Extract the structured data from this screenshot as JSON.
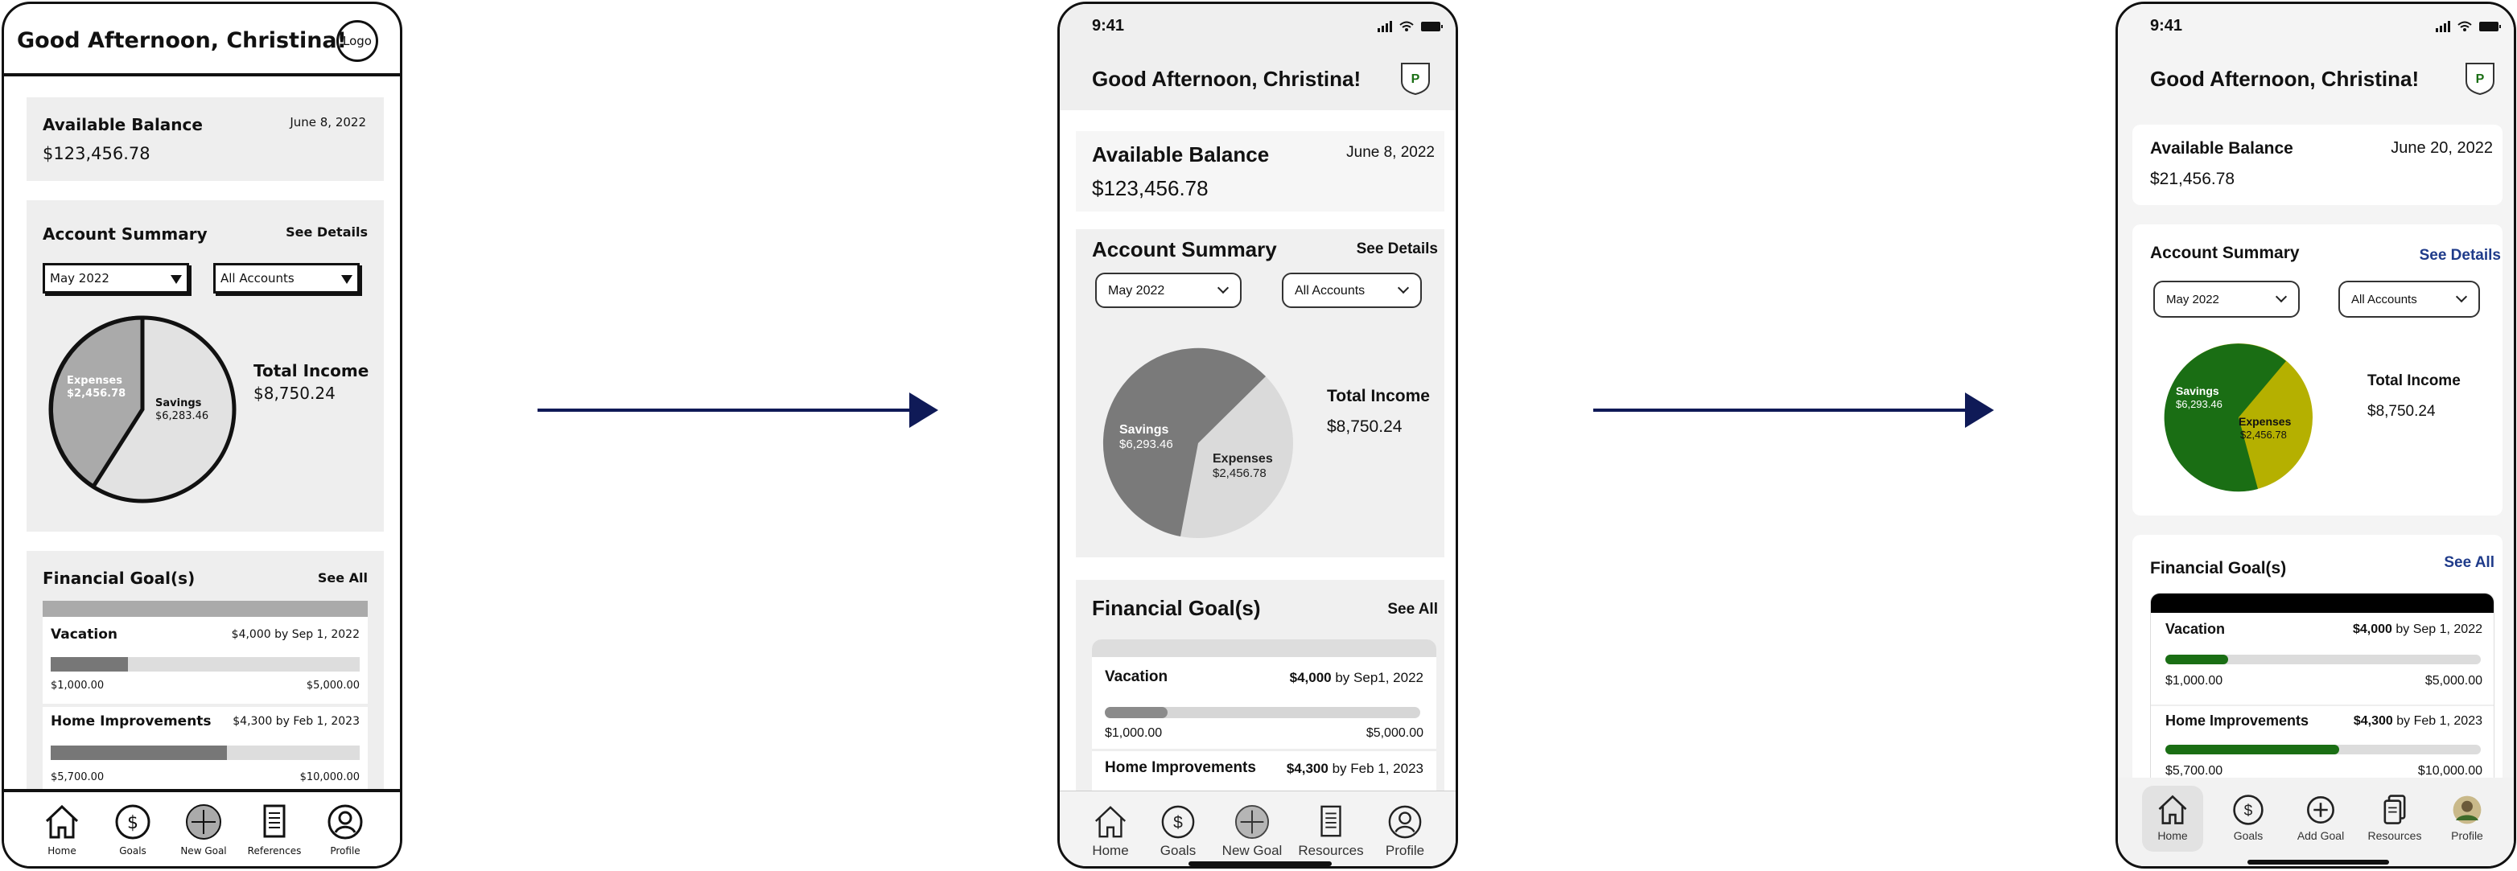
{
  "colors": {
    "arrow": "#0f1a57",
    "final_green": "#1a6e14",
    "final_yellow": "#b5b000",
    "final_link": "#1f3b8a",
    "wire_gray": "#eeeeee"
  },
  "screens": [
    {
      "greeting": "Good Afternoon, Christina!",
      "logo": "Logo",
      "balance": {
        "title": "Available Balance",
        "date": "June 8, 2022",
        "amount": "$123,456.78"
      },
      "summary": {
        "title": "Account Summary",
        "link": "See Details",
        "month": "May 2022",
        "accounts": "All Accounts",
        "pie": {
          "expenses_label": "Expenses",
          "expenses_value": "$2,456.78",
          "savings_label": "Savings",
          "savings_value": "$6,283.46"
        },
        "income_title": "Total Income",
        "income_value": "$8,750.24"
      },
      "goals": {
        "title": "Financial Goal(s)",
        "link": "See All",
        "items": [
          {
            "name": "Vacation",
            "target": "$4,000 by Sep 1, 2022",
            "current": "$1,000.00",
            "goal": "$5,000.00",
            "progress": 0.25
          },
          {
            "name": "Home Improvements",
            "target": "$4,300 by Feb 1, 2023",
            "current": "$5,700.00",
            "goal": "$10,000.00",
            "progress": 0.57
          }
        ]
      },
      "nav": [
        "Home",
        "Goals",
        "New Goal",
        "References",
        "Profile"
      ]
    },
    {
      "time": "9:41",
      "greeting": "Good Afternoon, Christina!",
      "balance": {
        "title": "Available Balance",
        "date": "June 8, 2022",
        "amount": "$123,456.78"
      },
      "summary": {
        "title": "Account Summary",
        "link": "See Details",
        "month": "May 2022",
        "accounts": "All Accounts",
        "pie": {
          "savings_label": "Savings",
          "savings_value": "$6,293.46",
          "expenses_label": "Expenses",
          "expenses_value": "$2,456.78"
        },
        "income_title": "Total Income",
        "income_value": "$8,750.24"
      },
      "goals": {
        "title": "Financial Goal(s)",
        "link": "See All",
        "items": [
          {
            "name": "Vacation",
            "amount": "$4,000",
            "by": "by Sep1, 2022",
            "current": "$1,000.00",
            "goal": "$5,000.00",
            "progress": 0.2
          },
          {
            "name": "Home Improvements",
            "amount": "$4,300",
            "by": "by Feb 1, 2023"
          }
        ]
      },
      "nav": [
        "Home",
        "Goals",
        "New Goal",
        "Resources",
        "Profile"
      ]
    },
    {
      "time": "9:41",
      "greeting": "Good Afternoon, Christina!",
      "balance": {
        "title": "Available Balance",
        "date": "June 20, 2022",
        "amount": "$21,456.78"
      },
      "summary": {
        "title": "Account Summary",
        "link": "See Details",
        "month": "May 2022",
        "accounts": "All Accounts",
        "pie": {
          "savings_label": "Savings",
          "savings_value": "$6,293.46",
          "expenses_label": "Expenses",
          "expenses_value": "$2,456.78"
        },
        "income_title": "Total Income",
        "income_value": "$8,750.24"
      },
      "goals": {
        "title": "Financial Goal(s)",
        "link": "See All",
        "items": [
          {
            "name": "Vacation",
            "amount": "$4,000",
            "by": "by Sep 1, 2022",
            "current": "$1,000.00",
            "goal": "$5,000.00",
            "progress": 0.2
          },
          {
            "name": "Home Improvements",
            "amount": "$4,300",
            "by": "by Feb 1, 2023",
            "current": "$5,700.00",
            "goal": "$10,000.00",
            "progress": 0.55
          }
        ]
      },
      "nav": [
        "Home",
        "Goals",
        "Add Goal",
        "Resources",
        "Profile"
      ]
    }
  ]
}
